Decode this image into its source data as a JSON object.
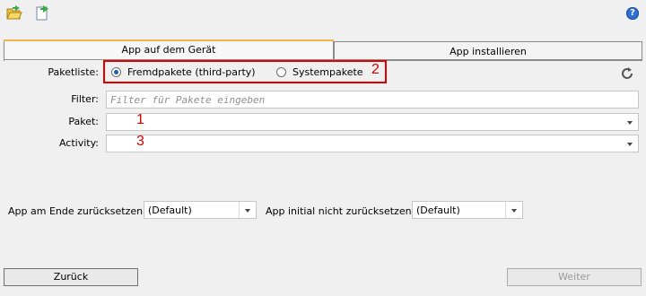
{
  "toolbar": {
    "open_icon": "folder-open-icon",
    "export_icon": "document-export-icon",
    "help_label": "?"
  },
  "tabs": [
    {
      "label": "App auf dem Gerät",
      "active": true
    },
    {
      "label": "App installieren",
      "active": false
    }
  ],
  "form": {
    "package_list_label": "Paketliste:",
    "radio_third_party": "Fremdpakete (third-party)",
    "radio_system": "Systempakete",
    "selected_radio": "third-party",
    "filter_label": "Filter:",
    "filter_placeholder": "Filter für Pakete eingeben",
    "filter_value": "",
    "package_label": "Paket:",
    "package_value": "",
    "activity_label": "Activity:",
    "activity_value": "",
    "refresh_icon": "refresh-icon"
  },
  "annotations": {
    "mark1": "1",
    "mark2": "2",
    "mark3": "3",
    "color": "#e00000"
  },
  "options": {
    "reset_at_end_label": "App am Ende zurücksetzen:",
    "reset_at_end_value": "(Default)",
    "no_initial_reset_label": "App initial nicht zurücksetzen:",
    "no_initial_reset_value": "(Default)"
  },
  "footer": {
    "back_label": "Zurück",
    "next_label": "Weiter",
    "next_enabled": false
  },
  "colors": {
    "tab_accent": "#f2b34b",
    "radio_dot": "#1c5fb8",
    "help_blue": "#2f6fd0"
  }
}
